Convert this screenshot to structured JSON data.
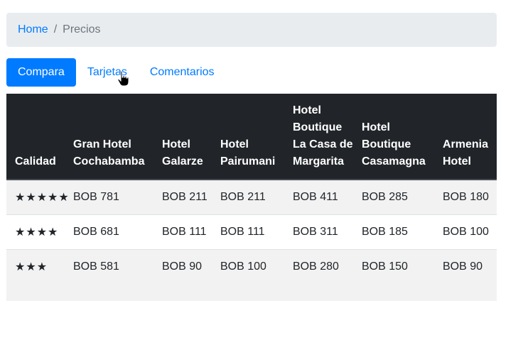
{
  "breadcrumb": {
    "home": "Home",
    "separator": "/",
    "current": "Precios"
  },
  "tabs": [
    {
      "label": "Compara",
      "active": true
    },
    {
      "label": "Tarjetas",
      "active": false
    },
    {
      "label": "Comentarios",
      "active": false
    }
  ],
  "table": {
    "headers": [
      "Calidad",
      "Gran Hotel Cochabamba",
      "Hotel Galarze",
      "Hotel Pairumani",
      "Hotel Boutique La Casa de Margarita",
      "Hotel Boutique Casamagna",
      "Armenia Hotel"
    ],
    "rows": [
      [
        "★★★★★",
        "BOB 781",
        "BOB 211",
        "BOB 211",
        "BOB 411",
        "BOB 285",
        "BOB 180"
      ],
      [
        "★★★★",
        "BOB 681",
        "BOB 111",
        "BOB 111",
        "BOB 311",
        "BOB 185",
        "BOB 100"
      ],
      [
        "★★★",
        "BOB 581",
        "BOB 90",
        "BOB 100",
        "BOB 280",
        "BOB 150",
        "BOB 90"
      ]
    ]
  },
  "colors": {
    "accent": "#007bff",
    "header_bg": "#212529",
    "breadcrumb_bg": "#e9ecef"
  },
  "cursor": "hand-pointer-icon"
}
